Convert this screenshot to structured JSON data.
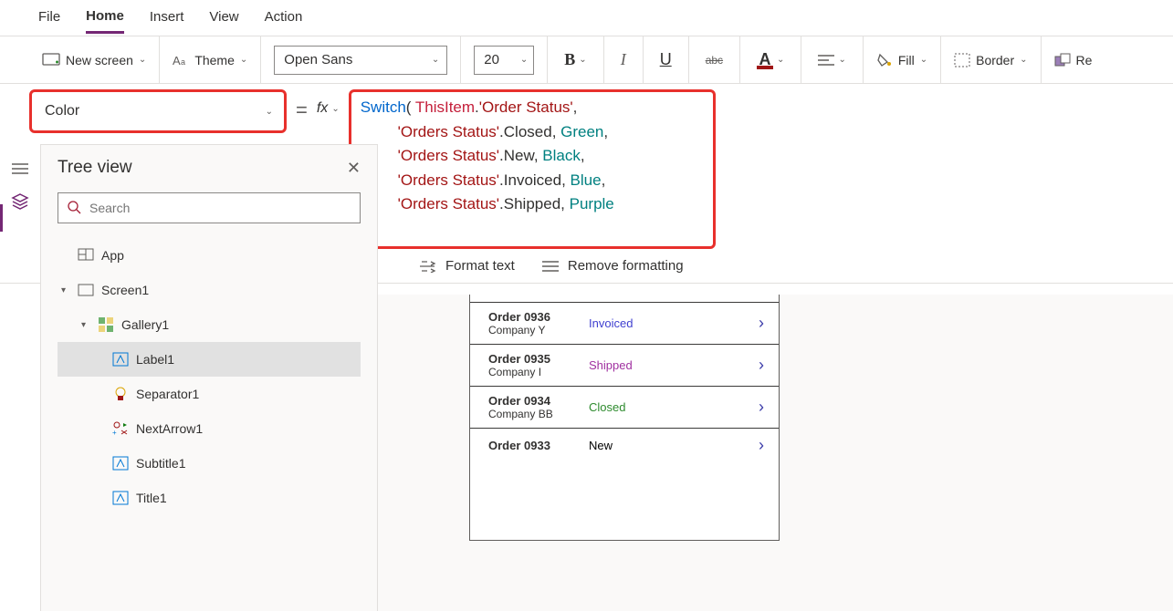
{
  "menu": {
    "items": [
      "File",
      "Home",
      "Insert",
      "View",
      "Action"
    ],
    "active": "Home"
  },
  "ribbon": {
    "new_screen": "New screen",
    "theme": "Theme",
    "font_family": "Open Sans",
    "font_size": "20",
    "fill": "Fill",
    "border": "Border",
    "reorder": "Re"
  },
  "property_select": "Color",
  "formula": {
    "line1_switch": "Switch",
    "line1_this": "ThisItem",
    "line1_prop": "'Order Status'",
    "orders_status": "'Orders Status'",
    "closed": "Closed",
    "green": "Green",
    "new": "New",
    "black": "Black",
    "invoiced": "Invoiced",
    "blue": "Blue",
    "shipped": "Shipped",
    "purple": "Purple"
  },
  "formula_toolbar": {
    "format_text": "Format text",
    "remove_formatting": "Remove formatting"
  },
  "tree": {
    "title": "Tree view",
    "search_placeholder": "Search",
    "app": "App",
    "screen1": "Screen1",
    "gallery1": "Gallery1",
    "label1": "Label1",
    "separator1": "Separator1",
    "nextarrow1": "NextArrow1",
    "subtitle1": "Subtitle1",
    "title1": "Title1"
  },
  "orders": [
    {
      "order": "Order 0936",
      "company": "Company Y",
      "status": "Invoiced",
      "color": "#4040d0"
    },
    {
      "order": "Order 0935",
      "company": "Company I",
      "status": "Shipped",
      "color": "#a030a0"
    },
    {
      "order": "Order 0934",
      "company": "Company BB",
      "status": "Closed",
      "color": "#2e8b2e"
    },
    {
      "order": "Order 0933",
      "company": "",
      "status": "New",
      "color": "#000000"
    }
  ]
}
